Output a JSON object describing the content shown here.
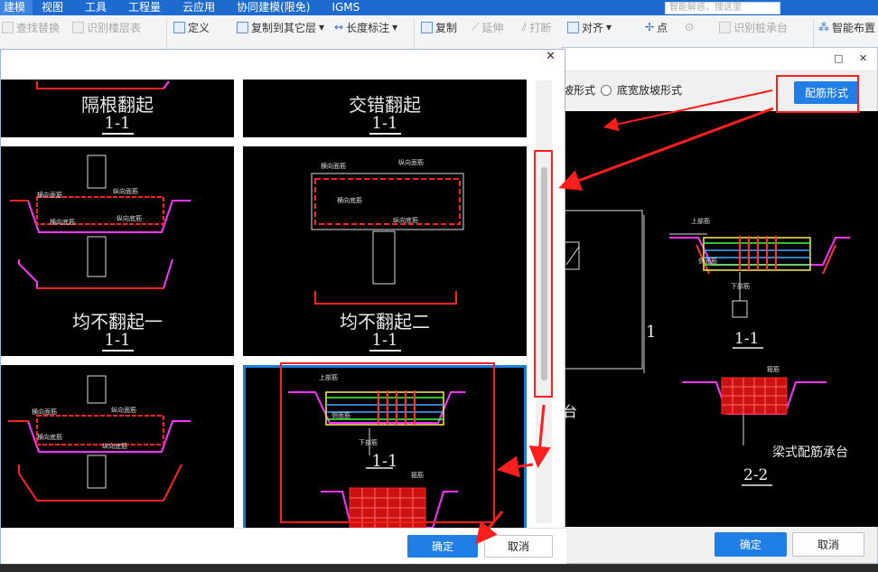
{
  "menu": {
    "items": [
      "建模",
      "视图",
      "工具",
      "工程量",
      "云应用",
      "协同建模(限免)",
      "IGMS"
    ],
    "search_placeholder": "智能解惑，搜这里"
  },
  "ribbon": {
    "find_replace": "查找替换",
    "identify_floor": "识别楼层表",
    "define": "定义",
    "copy_to_floor": "复制到其它层",
    "length_mark": "长度标注",
    "copy": "复制",
    "extend": "延伸",
    "break": "打断",
    "align": "对齐",
    "point": "点",
    "identify_pile": "识别桩承台",
    "smart_layout": "智能布置"
  },
  "back_dialog": {
    "option_slope": "坡形式",
    "option_bottom_wide": "底宽放坡形式",
    "rebar_form_button": "配筋形式",
    "label_one": "1",
    "label_tai": "台",
    "section_1": "1-1",
    "section_2": "2-2",
    "caption": "梁式配筋承台",
    "ok": "确定",
    "cancel": "取消",
    "rebar_labels": {
      "top": "上部筋",
      "side": "侧面筋",
      "bottom": "下部筋",
      "stirrup": "箍筋"
    }
  },
  "front_dialog": {
    "cells": [
      {
        "caption": "隔根翻起",
        "section": "1-1"
      },
      {
        "caption": "交错翻起",
        "section": "1-1"
      },
      {
        "caption": "均不翻起一",
        "section": "1-1"
      },
      {
        "caption": "均不翻起二",
        "section": "1-1"
      },
      {
        "caption": "",
        "section": ""
      },
      {
        "caption": "",
        "section": "1-1"
      }
    ],
    "rebar_labels": {
      "horiz_top": "横向面筋",
      "long_top": "纵向面筋",
      "horiz_bottom": "横向底筋",
      "long_bottom": "纵向底筋",
      "top": "上部筋",
      "side": "侧面筋",
      "bottom": "下部筋",
      "stirrup": "箍筋",
      "slope": "节点斜筋"
    },
    "ok": "确定",
    "cancel": "取消"
  },
  "colors": {
    "accent": "#1f7fe4",
    "annotation": "#ff1e1e",
    "cad_bg": "#000000",
    "rebar_red": "#ff2222",
    "rebar_green": "#33ff33",
    "outline_magenta": "#ff33ff"
  }
}
